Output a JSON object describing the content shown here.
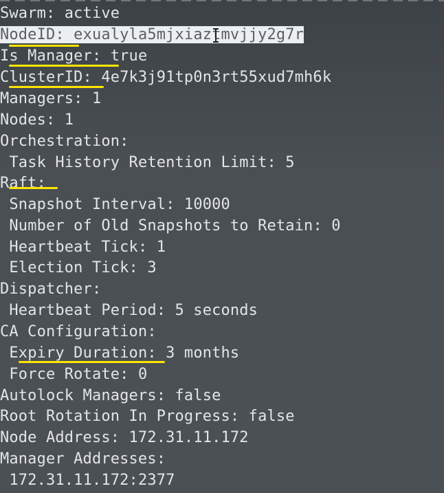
{
  "terminal": {
    "lines": [
      {
        "indent": "",
        "key": "Swarm:",
        "value": " active"
      },
      {
        "indent": "",
        "key": "NodeID:",
        "value": " exualyla5mjxiaztmvjjy2g7r"
      },
      {
        "indent": "",
        "key": "Is Manager:",
        "value": " true"
      },
      {
        "indent": "",
        "key": "ClusterID:",
        "value": " 4e7k3j91tp0n3rt55xud7mh6k"
      },
      {
        "indent": "",
        "key": "Managers:",
        "value": " 1"
      },
      {
        "indent": "",
        "key": "Nodes:",
        "value": " 1"
      },
      {
        "indent": "",
        "key": "Orchestration:",
        "value": ""
      },
      {
        "indent": " ",
        "key": "Task History Retention Limit:",
        "value": " 5"
      },
      {
        "indent": "",
        "key": "Raft:",
        "value": ""
      },
      {
        "indent": " ",
        "key": "Snapshot Interval:",
        "value": " 10000"
      },
      {
        "indent": " ",
        "key": "Number of Old Snapshots to Retain:",
        "value": " 0"
      },
      {
        "indent": " ",
        "key": "Heartbeat Tick:",
        "value": " 1"
      },
      {
        "indent": " ",
        "key": "Election Tick:",
        "value": " 3"
      },
      {
        "indent": "",
        "key": "Dispatcher:",
        "value": ""
      },
      {
        "indent": " ",
        "key": "Heartbeat Period:",
        "value": " 5 seconds"
      },
      {
        "indent": "",
        "key": "CA Configuration:",
        "value": ""
      },
      {
        "indent": " ",
        "key": "Expiry Duration:",
        "value": " 3 months"
      },
      {
        "indent": " ",
        "key": "Force Rotate:",
        "value": " 0"
      },
      {
        "indent": "",
        "key": "Autolock Managers:",
        "value": " false"
      },
      {
        "indent": "",
        "key": "Root Rotation In Progress:",
        "value": " false"
      },
      {
        "indent": "",
        "key": "Node Address:",
        "value": " 172.31.11.172"
      },
      {
        "indent": "",
        "key": "Manager Addresses:",
        "value": ""
      },
      {
        "indent": " ",
        "key": "172.31.11.172:2377",
        "value": ""
      }
    ]
  },
  "colors": {
    "background": "#474c51",
    "text": "#e3e5e7",
    "highlight_underline": "#ffe500",
    "selection_background": "#eceff1"
  }
}
